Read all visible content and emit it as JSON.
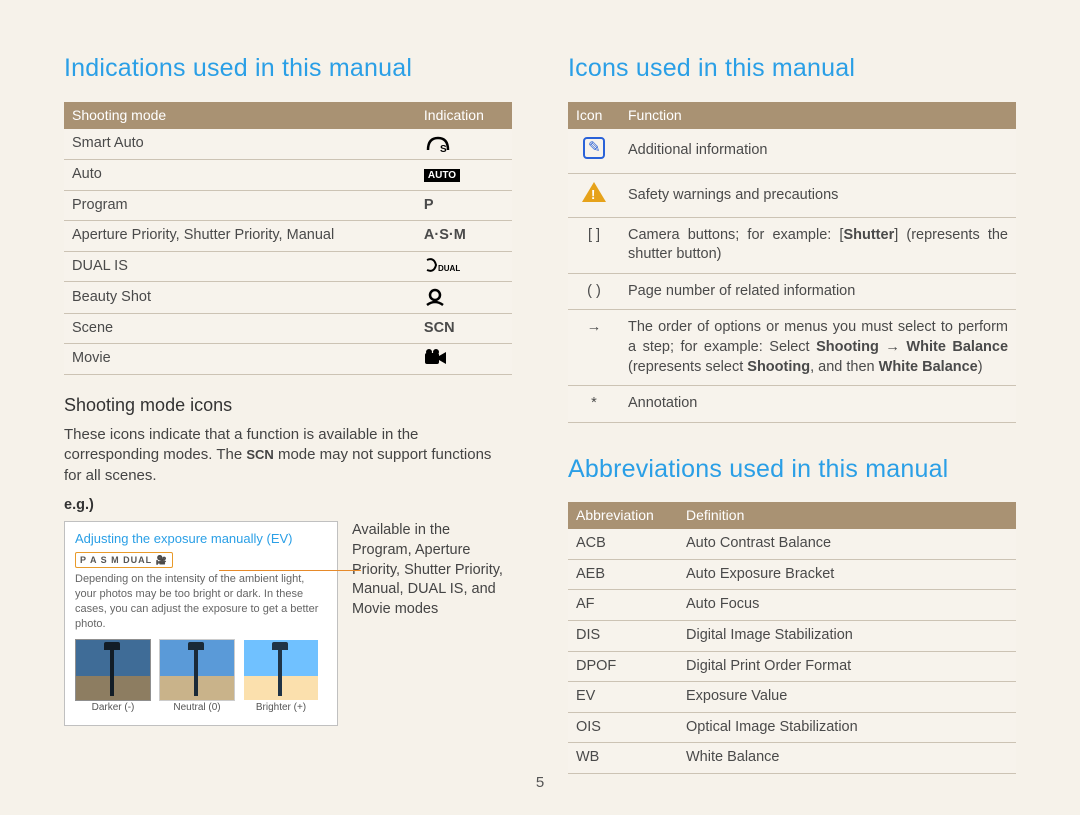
{
  "page_number": "5",
  "left": {
    "heading": "Indications used in this manual",
    "table": {
      "col1": "Shooting mode",
      "col2": "Indication",
      "rows": [
        {
          "mode": "Smart Auto",
          "indication_text": "S",
          "indication_key": "smart-auto"
        },
        {
          "mode": "Auto",
          "indication_text": "AUTO",
          "indication_key": "auto"
        },
        {
          "mode": "Program",
          "indication_text": "P",
          "indication_key": "program"
        },
        {
          "mode": "Aperture Priority, Shutter Priority, Manual",
          "indication_text": "A·S·M",
          "indication_key": "asm"
        },
        {
          "mode": "DUAL IS",
          "indication_text": "DUAL",
          "indication_key": "dual-is"
        },
        {
          "mode": "Beauty Shot",
          "indication_text": "",
          "indication_key": "beauty"
        },
        {
          "mode": "Scene",
          "indication_text": "SCN",
          "indication_key": "scene"
        },
        {
          "mode": "Movie",
          "indication_text": "",
          "indication_key": "movie"
        }
      ]
    },
    "sub_heading": "Shooting mode icons",
    "sub_text_parts": {
      "a": "These icons indicate that a function is available in the corresponding modes. The ",
      "scn": "SCN",
      "b": " mode may not support functions for all scenes."
    },
    "eg_label": "e.g.)",
    "example": {
      "title": "Adjusting the exposure manually (EV)",
      "mode_strip": "P A S M  DUAL  🎥",
      "body": "Depending on the intensity of the ambient light, your photos may be too bright or dark. In these cases, you can adjust the exposure to get a better photo.",
      "thumbs": [
        "Darker (-)",
        "Neutral (0)",
        "Brighter (+)"
      ],
      "caption": "Available in the Program, Aperture Priority, Shutter Priority, Manual, DUAL IS, and Movie modes"
    }
  },
  "right": {
    "icons_heading": "Icons used in this manual",
    "icons_table": {
      "col1": "Icon",
      "col2": "Function",
      "rows": [
        {
          "key": "info",
          "symbol": "",
          "function": "Additional information"
        },
        {
          "key": "warn",
          "symbol": "",
          "function": "Safety warnings and precautions"
        },
        {
          "key": "brackets",
          "symbol": "[ ]",
          "function_parts": {
            "a": "Camera buttons; for example: [",
            "b": "Shutter",
            "c": "] (represents the shutter button)"
          }
        },
        {
          "key": "parens",
          "symbol": "( )",
          "function": "Page number of related information"
        },
        {
          "key": "arrow",
          "symbol": "→",
          "function_parts": {
            "a": "The order of options or menus you must select to perform a step; for example: Select ",
            "b": "Shooting",
            "c": " → ",
            "d": "White Balance",
            "e": " (represents select ",
            "f": "Shooting",
            "g": ", and then ",
            "h": "White Balance",
            "i": ")"
          }
        },
        {
          "key": "asterisk",
          "symbol": "*",
          "function": "Annotation"
        }
      ]
    },
    "abbrev_heading": "Abbreviations used in this manual",
    "abbrev_table": {
      "col1": "Abbreviation",
      "col2": "Definition",
      "rows": [
        {
          "abbr": "ACB",
          "def": "Auto Contrast Balance"
        },
        {
          "abbr": "AEB",
          "def": "Auto Exposure Bracket"
        },
        {
          "abbr": "AF",
          "def": "Auto Focus"
        },
        {
          "abbr": "DIS",
          "def": "Digital Image Stabilization"
        },
        {
          "abbr": "DPOF",
          "def": "Digital Print Order Format"
        },
        {
          "abbr": "EV",
          "def": "Exposure Value"
        },
        {
          "abbr": "OIS",
          "def": "Optical Image Stabilization"
        },
        {
          "abbr": "WB",
          "def": "White Balance"
        }
      ]
    }
  }
}
